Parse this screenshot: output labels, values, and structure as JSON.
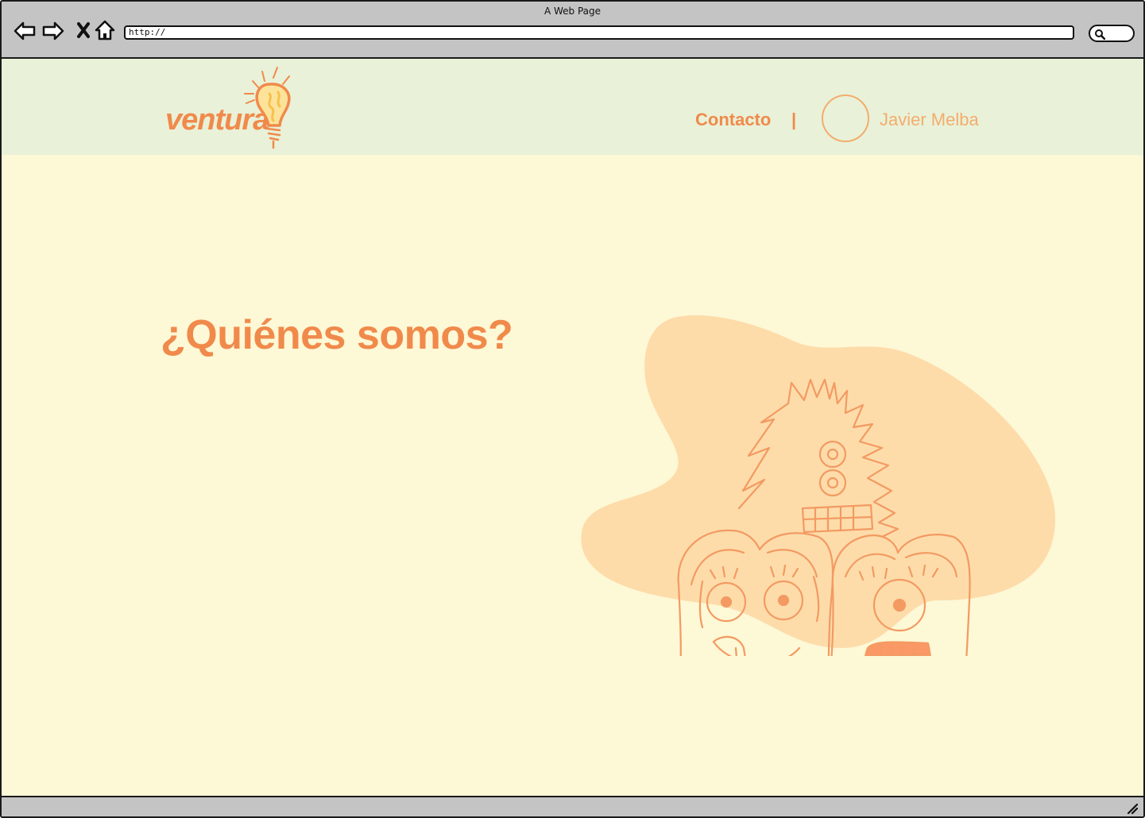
{
  "window": {
    "title": "A Web Page",
    "url": "http://"
  },
  "toolbar_icons": [
    "back-arrow-icon",
    "forward-arrow-icon",
    "close-x-icon",
    "home-icon",
    "search-icon"
  ],
  "site": {
    "logo_text": "ventura",
    "nav": {
      "contact_label": "Contacto",
      "separator": "|",
      "user_name": "Javier Melba"
    }
  },
  "main": {
    "heading": "¿Quiénes somos?"
  },
  "colors": {
    "brand_orange": "#f08a4b",
    "light_orange": "#f3ad6e",
    "header_bg": "#e9f1d8",
    "page_bg": "#fdf8d6",
    "blob": "#fddcaa"
  }
}
